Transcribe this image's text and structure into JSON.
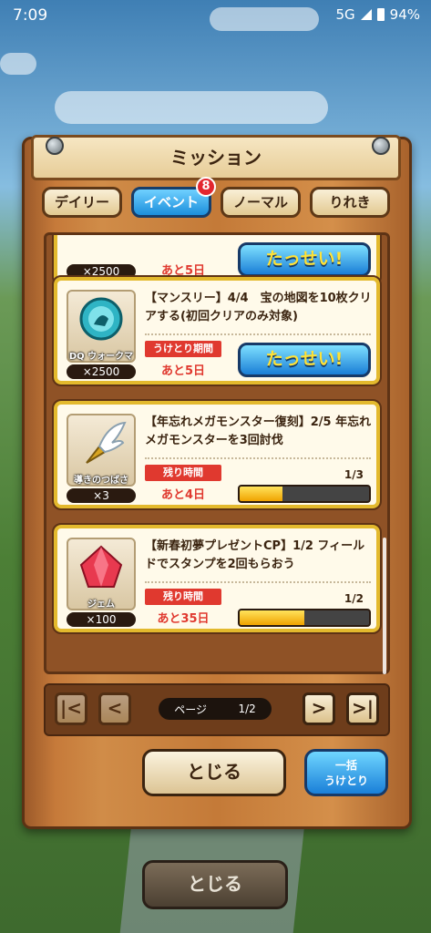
{
  "status": {
    "time": "7:09",
    "network": "5G",
    "battery": "94%"
  },
  "title": "ミッション",
  "tabs": [
    {
      "label": "デイリー",
      "active": false
    },
    {
      "label": "イベント",
      "active": true,
      "badge": "8"
    },
    {
      "label": "ノーマル",
      "active": false
    },
    {
      "label": "りれき",
      "active": false
    }
  ],
  "missions": [
    {
      "item_qty": "×2500",
      "time_value": "あと5日",
      "action": "たっせい!"
    },
    {
      "text": "【マンスリー】4/4　宝の地図を10枚クリアする(初回クリアのみ対象)",
      "item_name": "DQ ウォークマイレージ",
      "item_qty": "×2500",
      "time_label": "うけとり期間",
      "time_value": "あと5日",
      "action": "たっせい!"
    },
    {
      "text": "【年忘れメガモンスター復刻】2/5 年忘れメガモンスターを3回討伐",
      "item_name": "導きのつばさ",
      "item_qty": "×3",
      "time_label": "残り時間",
      "time_value": "あと4日",
      "progress_text": "1/3",
      "progress": 0.33
    },
    {
      "text": "【新春初夢プレゼントCP】1/2 フィールドでスタンプを2回もらおう",
      "item_name": "ジェム",
      "item_qty": "×100",
      "time_label": "残り時間",
      "time_value": "あと35日",
      "progress_text": "1/2",
      "progress": 0.5
    }
  ],
  "pager": {
    "label": "ページ",
    "value": "1/2"
  },
  "buttons": {
    "close": "とじる",
    "claim_all_1": "一括",
    "claim_all_2": "うけとり",
    "close_outer": "とじる"
  },
  "colors": {
    "accent_blue": "#1c8fdc",
    "wood": "#c67a3a",
    "alert_red": "#e0392f",
    "progress_yellow": "#f0a300"
  }
}
